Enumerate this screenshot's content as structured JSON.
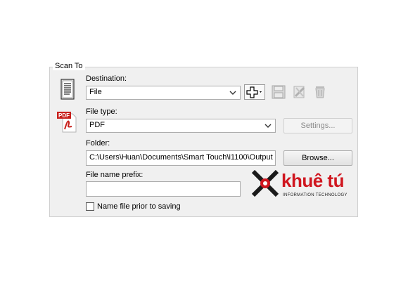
{
  "group": {
    "title": "Scan To"
  },
  "destination": {
    "label": "Destination:",
    "value": "File"
  },
  "file_type": {
    "label": "File type:",
    "value": "PDF",
    "settings_label": "Settings...",
    "icon_label": "PDF"
  },
  "folder": {
    "label": "Folder:",
    "value": "C:\\Users\\Huan\\Documents\\Smart Touch\\i1100\\Output",
    "browse_label": "Browse..."
  },
  "prefix": {
    "label": "File name prefix:",
    "value": ""
  },
  "option": {
    "label": "Name file prior to saving",
    "checked": false
  },
  "watermark": {
    "brand": "khuê tú",
    "tagline": "INFORMATION TECHNOLOGY"
  },
  "colors": {
    "panel": "#f0f0f0",
    "pdf_red": "#c8201c",
    "logo_red": "#d0161f"
  }
}
